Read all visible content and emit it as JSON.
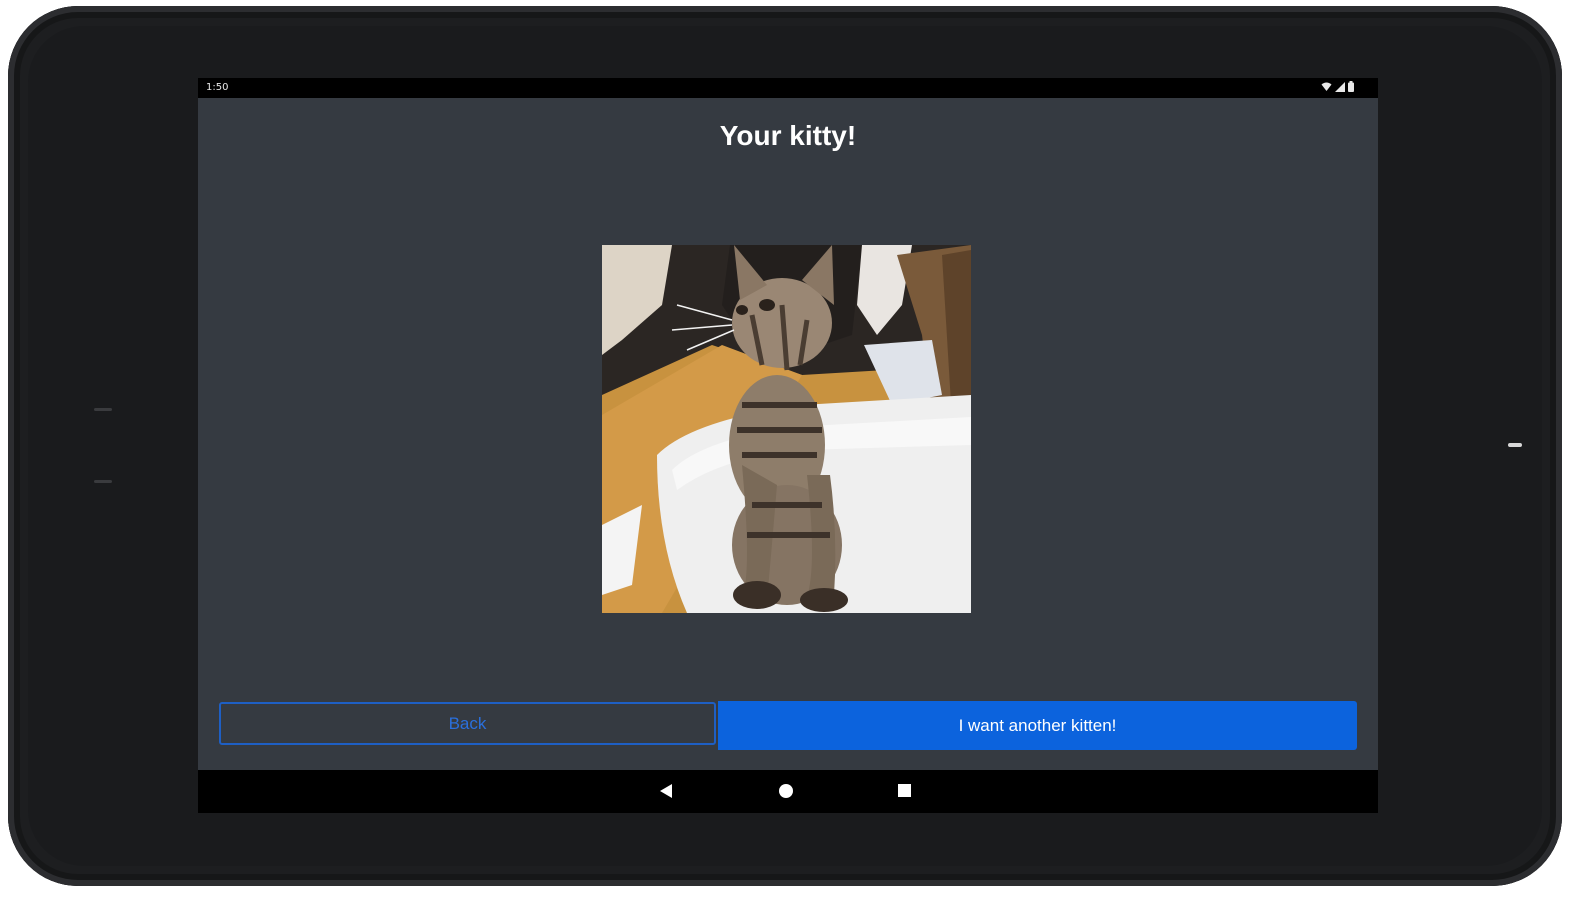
{
  "status_bar": {
    "time": "1:50",
    "icons": [
      "wifi-icon",
      "signal-icon",
      "battery-icon"
    ]
  },
  "page": {
    "title": "Your kitty!"
  },
  "photo": {
    "subject": "kitten-photo"
  },
  "buttons": {
    "back_label": "Back",
    "another_label": "I want another kitten!"
  },
  "nav_bar": {
    "icons": [
      "nav-back-icon",
      "nav-home-icon",
      "nav-recents-icon"
    ]
  },
  "colors": {
    "screen_background": "#353a41",
    "accent": "#0c63dd",
    "outline_button_text": "#2a6fdc"
  }
}
